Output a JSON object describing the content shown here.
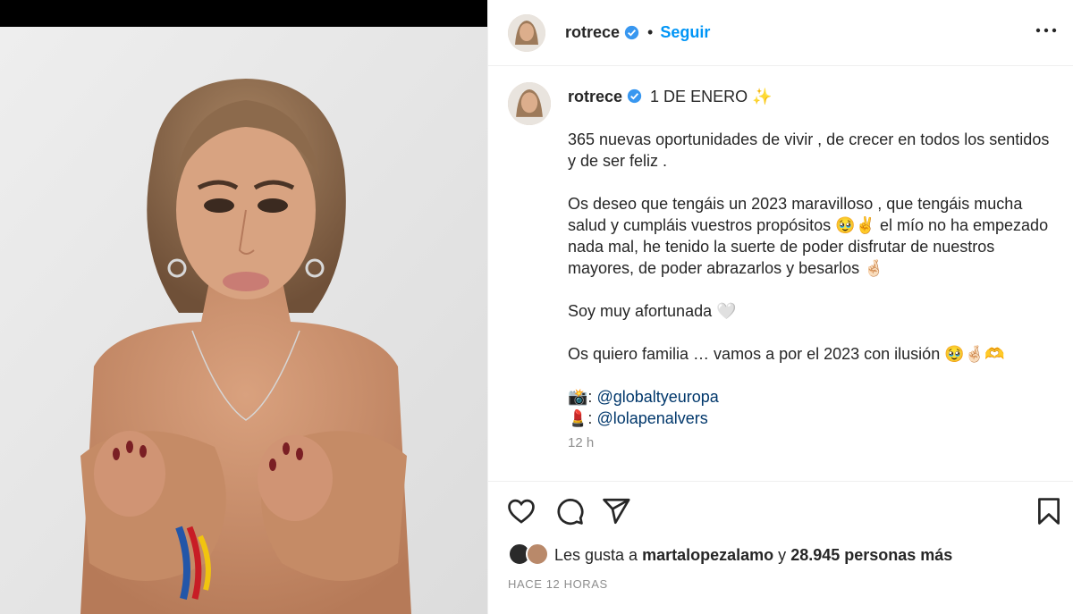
{
  "post": {
    "username": "rotrece",
    "follow_label": "Seguir",
    "dot": "•"
  },
  "caption": {
    "username": "rotrece",
    "headline": "1 DE ENERO",
    "headline_emoji": "✨",
    "paragraphs": [
      "365 nuevas oportunidades de vivir , de crecer en todos los sentidos y de ser feliz .",
      "Os deseo que tengáis un 2023 maravilloso , que tengáis mucha salud y cumpláis vuestros propósitos 🥹✌️ el mío no ha empezado nada mal, he tenido la suerte de poder disfrutar de nuestros mayores, de poder abrazarlos y besarlos 🤞🏻",
      "Soy muy afortunada 🤍",
      "Os quiero familia … vamos a por el 2023 con ilusión 🥹🤞🏻🫶"
    ],
    "credits": [
      {
        "emoji": "📸",
        "sep": ": ",
        "mention": "@globaltyeuropa"
      },
      {
        "emoji": "💄",
        "sep": ": ",
        "mention": "@lolapenalvers"
      }
    ],
    "time": "12 h"
  },
  "actions": {
    "icons": [
      "heart-icon",
      "comment-icon",
      "share-icon",
      "bookmark-icon"
    ]
  },
  "likes": {
    "prefix": "Les gusta a",
    "user": "martalopezalamo",
    "conj": "y",
    "count_text": "28.945 personas más"
  },
  "ago": "HACE 12 HORAS",
  "colors": {
    "accent": "#0095f6",
    "mention": "#00376b",
    "muted": "#8e8e8e",
    "text": "#262626"
  }
}
